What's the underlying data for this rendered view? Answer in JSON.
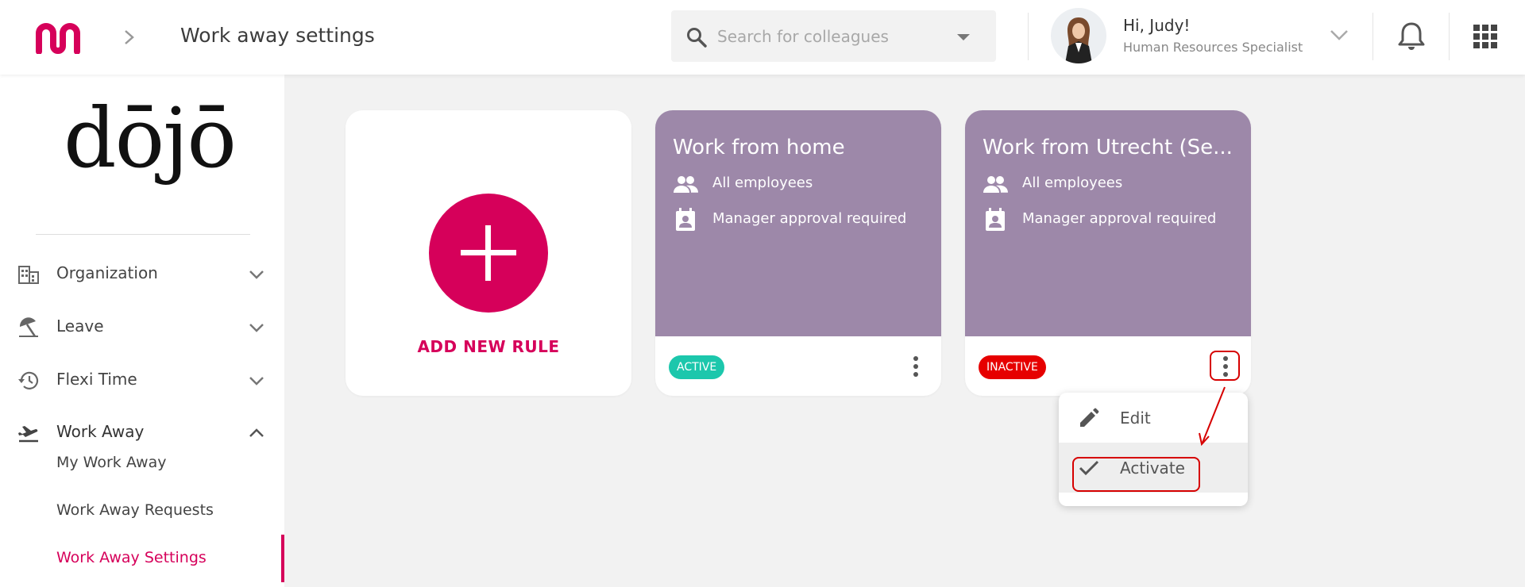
{
  "header": {
    "page_title": "Work away settings",
    "search_placeholder": "Search for colleagues",
    "greeting": "Hi, Judy!",
    "role": "Human Resources Specialist"
  },
  "sidebar": {
    "brand": "dōjō",
    "items": [
      {
        "label": "Organization",
        "icon": "building-icon",
        "expanded": false
      },
      {
        "label": "Leave",
        "icon": "beach-umbrella-icon",
        "expanded": false
      },
      {
        "label": "Flexi Time",
        "icon": "history-clock-icon",
        "expanded": false
      },
      {
        "label": "Work Away",
        "icon": "flight-takeoff-icon",
        "expanded": true
      }
    ],
    "sub_items": [
      {
        "label": "My Work Away"
      },
      {
        "label": "Work Away Requests"
      },
      {
        "label": "Work Away Settings",
        "active": true
      }
    ]
  },
  "add_card": {
    "label": "ADD NEW RULE"
  },
  "rules": [
    {
      "title": "Work from home",
      "audience": "All employees",
      "approval": "Manager approval required",
      "status": "ACTIVE",
      "status_color": "#1cc7ac"
    },
    {
      "title": "Work from Utrecht (Se...",
      "audience": "All employees",
      "approval": "Manager approval required",
      "status": "INACTIVE",
      "status_color": "#e60000"
    }
  ],
  "menu": {
    "items": [
      {
        "label": "Edit",
        "icon": "pencil-icon"
      },
      {
        "label": "Activate",
        "icon": "check-icon",
        "highlighted": true
      }
    ]
  },
  "colors": {
    "accent": "#d6005a",
    "card_purple": "#9d88a9",
    "annotation_red": "#d60000"
  }
}
